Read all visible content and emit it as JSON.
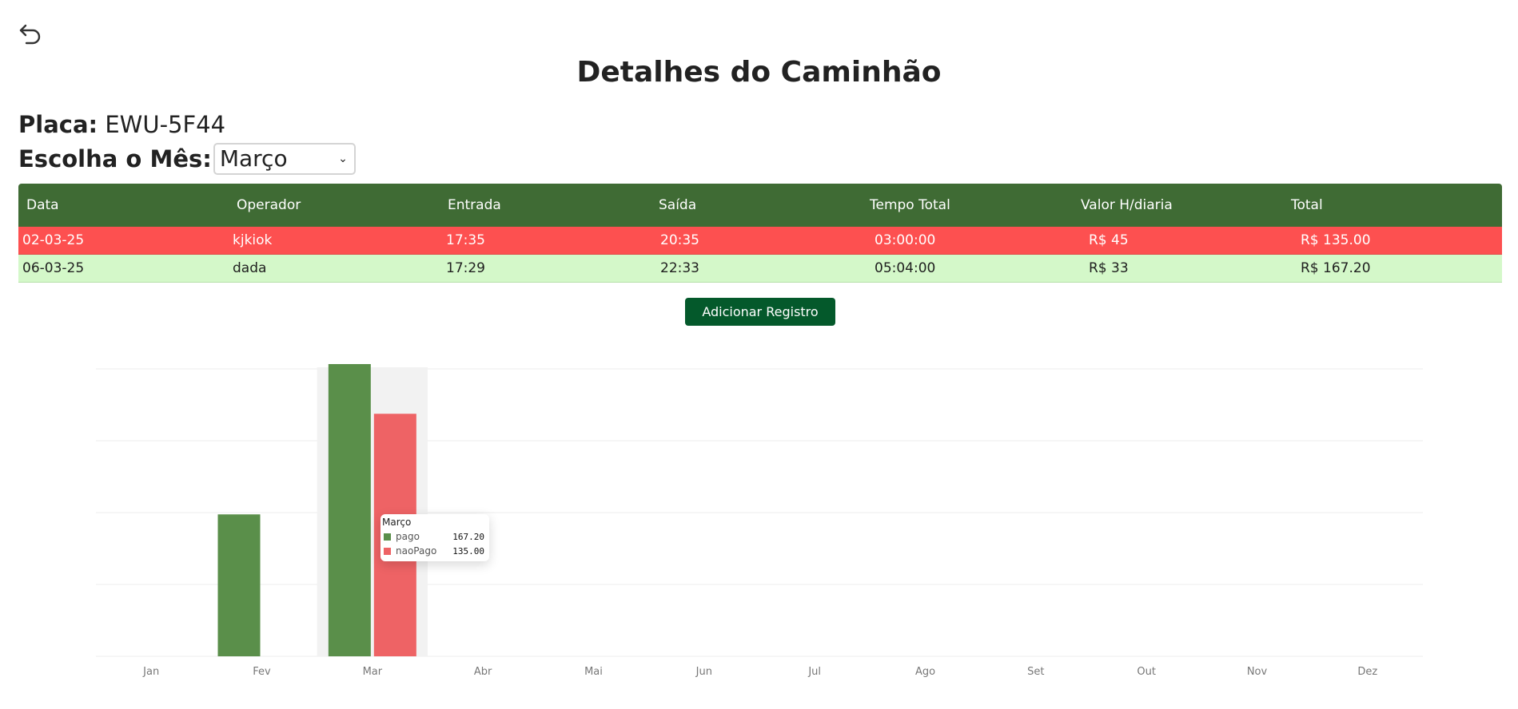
{
  "page": {
    "title": "Detalhes do Caminhão",
    "back_icon": "undo-arrow-icon"
  },
  "plate": {
    "label": "Placa:",
    "value": "EWU-5F44"
  },
  "month_picker": {
    "label": "Escolha o Mês:",
    "selected": "Março"
  },
  "table": {
    "headers": [
      "Data",
      "Operador",
      "Entrada",
      "Saída",
      "Tempo Total",
      "Valor H/diaria",
      "Total"
    ],
    "rows": [
      {
        "status": "naoPago",
        "cells": [
          "02-03-25",
          "kjkiok",
          "17:35",
          "20:35",
          "03:00:00",
          "R$ 45",
          "R$ 135.00"
        ]
      },
      {
        "status": "pago",
        "cells": [
          "06-03-25",
          "dada",
          "17:29",
          "22:33",
          "05:04:00",
          "R$ 33",
          "R$ 167.20"
        ]
      }
    ]
  },
  "add_button": {
    "label": "Adicionar Registro"
  },
  "colors": {
    "header": "#3f6b34",
    "pago": "#5a8f4a",
    "naoPago": "#ee6365",
    "unpaid_row": "#fd5050",
    "paid_row": "#d4f8c9",
    "button": "#04592b"
  },
  "tooltip": {
    "title": "Março",
    "items": [
      {
        "name": "pago",
        "value": "167.20"
      },
      {
        "name": "naoPago",
        "value": "135.00"
      }
    ]
  },
  "chart_data": {
    "type": "bar",
    "categories": [
      "Jan",
      "Fev",
      "Mar",
      "Abr",
      "Mai",
      "Jun",
      "Jul",
      "Ago",
      "Set",
      "Out",
      "Nov",
      "Dez"
    ],
    "series": [
      {
        "name": "pago",
        "values": [
          0,
          79,
          167.2,
          0,
          0,
          0,
          0,
          0,
          0,
          0,
          0,
          0
        ]
      },
      {
        "name": "naoPago",
        "values": [
          0,
          0,
          135,
          0,
          0,
          0,
          0,
          0,
          0,
          0,
          0,
          0
        ]
      }
    ],
    "ylim": [
      0,
      160
    ],
    "grid": true,
    "highlighted_category": "Mar"
  }
}
